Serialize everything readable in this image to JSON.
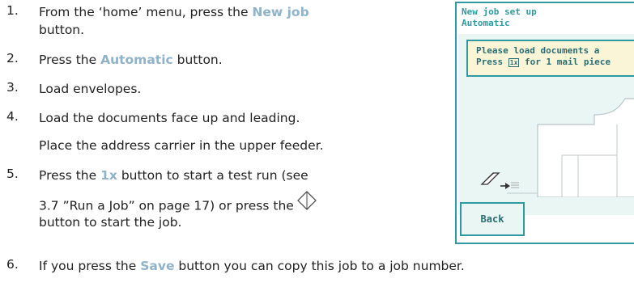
{
  "steps": [
    {
      "num": "1.",
      "parts": [
        "From the ‘home’ menu, press the ",
        "New job"
      ],
      "line2": "button."
    },
    {
      "num": "2.",
      "parts": [
        "Press the ",
        "Automatic",
        " button."
      ]
    },
    {
      "num": "3.",
      "text": "Load envelopes."
    },
    {
      "num": "4.",
      "text": "Load the documents face up and leading.",
      "line2": "Place the address carrier in the upper feeder."
    },
    {
      "num": "5.",
      "parts": [
        "Press the ",
        "1x",
        " button to start a test run (see"
      ],
      "line2": "3.7 ”Run a Job” on page 17) or press the",
      "line3": "button to start the job."
    },
    {
      "num": "6.",
      "parts": [
        "If you press the ",
        "Save",
        " button you can copy this job to a job number."
      ]
    }
  ],
  "device": {
    "title_line1": "New job set up",
    "title_line2": "Automatic",
    "message_line1": "Please load documents a",
    "message_line2_pre": "Press ",
    "message_icon": "1x",
    "message_line2_post": " for 1 mail piece",
    "back_label": "Back"
  },
  "icons": {
    "start": "diamond-start-icon",
    "feed": "document-feed-icon"
  },
  "colors": {
    "keyword": "#8fb3c8",
    "device_border": "#2e9aa0",
    "device_bg": "#e9f6f4",
    "message_bg": "#fbf5d8"
  }
}
